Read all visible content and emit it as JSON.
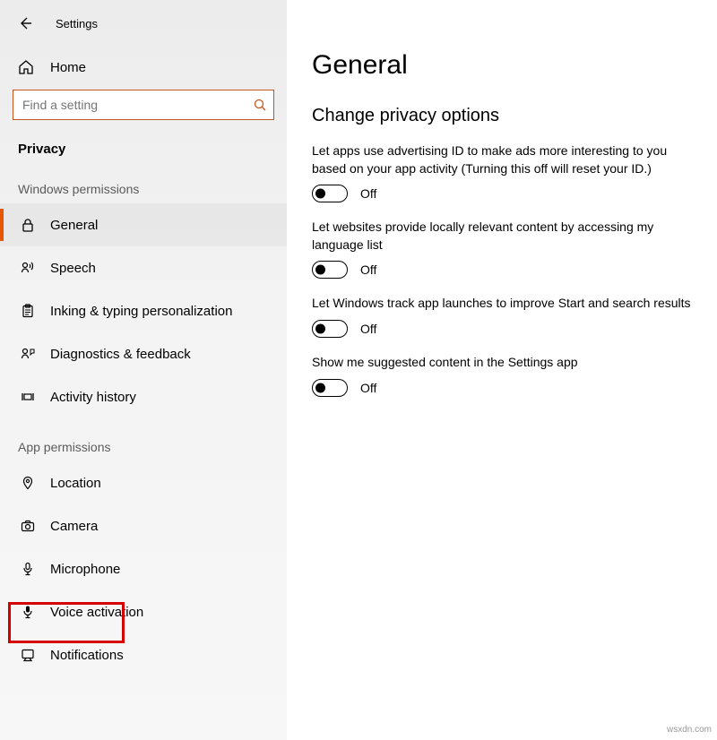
{
  "app_title": "Settings",
  "home_label": "Home",
  "search": {
    "placeholder": "Find a setting"
  },
  "section_title": "Privacy",
  "groups": {
    "windows_permissions": {
      "label": "Windows permissions",
      "items": {
        "general": "General",
        "speech": "Speech",
        "inking": "Inking & typing personalization",
        "diagnostics": "Diagnostics & feedback",
        "activity": "Activity history"
      }
    },
    "app_permissions": {
      "label": "App permissions",
      "items": {
        "location": "Location",
        "camera": "Camera",
        "microphone": "Microphone",
        "voice_activation": "Voice activation",
        "notifications": "Notifications"
      }
    }
  },
  "main": {
    "heading": "General",
    "subheading": "Change privacy options",
    "settings": [
      {
        "desc": "Let apps use advertising ID to make ads more interesting to you based on your app activity (Turning this off will reset your ID.)",
        "state": "Off"
      },
      {
        "desc": "Let websites provide locally relevant content by accessing my language list",
        "state": "Off"
      },
      {
        "desc": "Let Windows track app launches to improve Start and search results",
        "state": "Off"
      },
      {
        "desc": "Show me suggested content in the Settings app",
        "state": "Off"
      }
    ]
  },
  "watermark": "wsxdn.com"
}
